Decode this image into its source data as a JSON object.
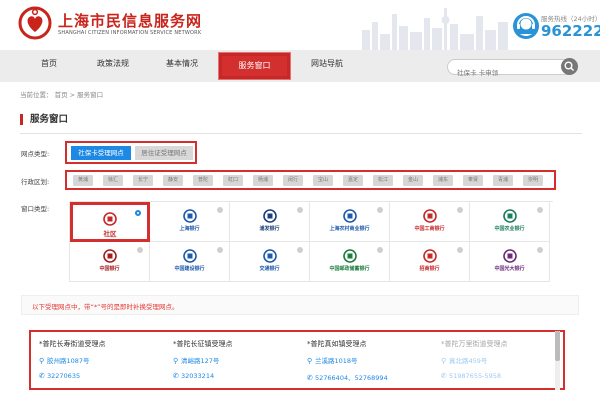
{
  "header": {
    "title": "上海市民信息服务网",
    "subtitle": "SHANGHAI CITIZEN INFORMATION SERVICE NETWORK",
    "hotline_label": "服务热线（24小时）",
    "hotline_number": "962222"
  },
  "nav": {
    "items": [
      "首页",
      "政策法规",
      "基本情况",
      "服务窗口",
      "网站导航"
    ],
    "active_index": 3,
    "search_placeholder": "社保卡 卡申领"
  },
  "breadcrumb": "当前位置： 首页 > 服务窗口",
  "section_title": "服务窗口",
  "labels": {
    "outlet_type": "网点类型:",
    "district": "行政区划:",
    "window_type": "窗口类型:"
  },
  "outlet_types": [
    {
      "label": "社保卡受理网点",
      "selected": true
    },
    {
      "label": "居住证受理网点",
      "selected": false
    }
  ],
  "districts": [
    "黄浦",
    "徐汇",
    "长宁",
    "静安",
    "普陀",
    "虹口",
    "杨浦",
    "闵行",
    "宝山",
    "嘉定",
    "松江",
    "金山",
    "浦东",
    "奉贤",
    "青浦",
    "崇明"
  ],
  "banks": [
    {
      "name": "社区",
      "selected": true,
      "color": "#c62828",
      "icon": "community-heart-icon"
    },
    {
      "name": "上海银行",
      "selected": false,
      "color": "#1e5aa8",
      "icon": "bank-of-shanghai-icon"
    },
    {
      "name": "浦发银行",
      "selected": false,
      "color": "#1a3f7a",
      "icon": "spdb-icon"
    },
    {
      "name": "上海农村商业银行",
      "selected": false,
      "color": "#1e5aa8",
      "icon": "rural-commercial-bank-icon"
    },
    {
      "name": "中国工商银行",
      "selected": false,
      "color": "#c62828",
      "icon": "icbc-icon"
    },
    {
      "name": "中国农业银行",
      "selected": false,
      "color": "#1b7c5e",
      "icon": "abc-icon"
    },
    {
      "name": "中国银行",
      "selected": false,
      "color": "#a31d1d",
      "icon": "boc-icon"
    },
    {
      "name": "中国建设银行",
      "selected": false,
      "color": "#1e5aa8",
      "icon": "ccb-icon"
    },
    {
      "name": "交通银行",
      "selected": false,
      "color": "#1e5aa8",
      "icon": "bocom-icon"
    },
    {
      "name": "中国邮政储蓄银行",
      "selected": false,
      "color": "#1b7c3c",
      "icon": "psbc-icon"
    },
    {
      "name": "招商银行",
      "selected": false,
      "color": "#c62828",
      "icon": "cmb-icon"
    },
    {
      "name": "中国光大银行",
      "selected": false,
      "color": "#6b2a7a",
      "icon": "ceb-icon"
    }
  ],
  "notice": "以下受理网点中，带“*”号的是即时补换受理网点。",
  "results": [
    {
      "name": "*普陀长寿街道受理点",
      "address": "胶州路1087号",
      "phone": "32270635"
    },
    {
      "name": "*普陀长征镇受理点",
      "address": "清峪路127号",
      "phone": "32033214"
    },
    {
      "name": "*普陀真如镇受理点",
      "address": "兰溪路1018号",
      "phone": "52766404、52768994"
    },
    {
      "name": "*普陀万里街道受理点",
      "address": "真北路459号",
      "phone": "51987655-5958"
    }
  ]
}
